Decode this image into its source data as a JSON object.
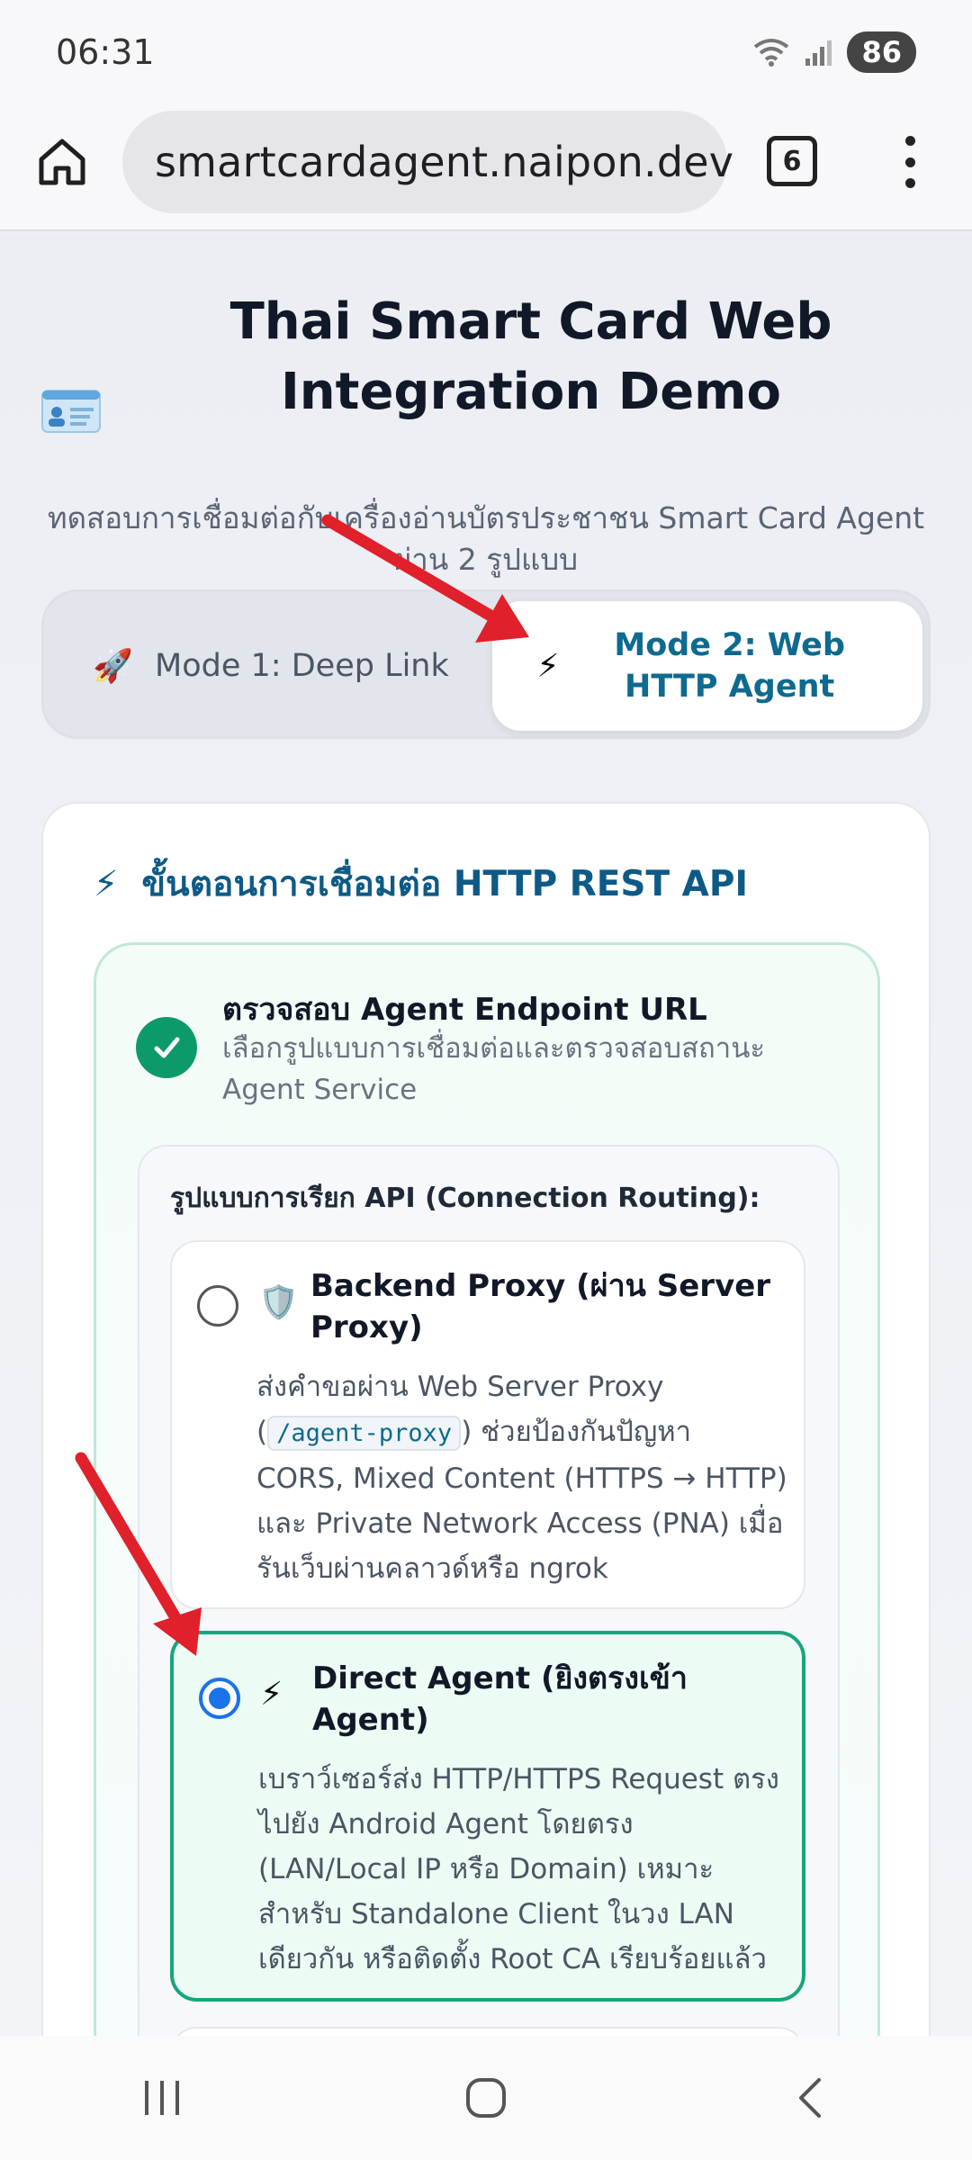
{
  "status_bar": {
    "time": "06:31",
    "battery": "86"
  },
  "browser": {
    "url": "smartcardagent.naipon.dev",
    "tab_count": "6"
  },
  "header": {
    "title": "Thai Smart Card Web Integration Demo",
    "subtitle": "ทดสอบการเชื่อมต่อกับเครื่องอ่านบัตรประชาชน Smart Card Agent ผ่าน 2 รูปแบบ"
  },
  "mode_tabs": [
    {
      "icon": "🚀",
      "label": "Mode 1: Deep Link",
      "active": false
    },
    {
      "icon": "⚡",
      "label": "Mode 2: Web HTTP Agent",
      "active": true
    }
  ],
  "card": {
    "icon": "⚡",
    "heading": "ขั้นตอนการเชื่อมต่อ HTTP REST API",
    "step": {
      "title": "ตรวจสอบ Agent Endpoint URL",
      "description": "เลือกรูปแบบการเชื่อมต่อและตรวจสอบสถานะ Agent Service",
      "routing_label": "รูปแบบการเรียก API (Connection Routing):",
      "options": [
        {
          "icon": "🛡️",
          "title": "Backend Proxy (ผ่าน Server Proxy)",
          "desc_before": "ส่งคำขอผ่าน Web Server Proxy (",
          "code": "/agent-proxy",
          "desc_after": ") ช่วยป้องกันปัญหา CORS, Mixed Content (HTTPS → HTTP) และ Private Network Access (PNA) เมื่อรันเว็บผ่านคลาวด์หรือ ngrok",
          "selected": false
        },
        {
          "icon": "⚡",
          "title": "Direct Agent (ยิงตรงเข้า Agent)",
          "desc": "เบราว์เซอร์ส่ง HTTP/HTTPS Request ตรงไปยัง Android Agent โดยตรง (LAN/Local IP หรือ Domain) เหมาะสำหรับ Standalone Client ในวง LAN เดียวกัน หรือติดตั้ง Root CA เรียบร้อยแล้ว",
          "selected": true
        }
      ]
    }
  },
  "colors": {
    "accent": "#0e6a8f",
    "success": "#0d9a6b",
    "selected_border": "#17a67c",
    "annotation_arrow": "#e0202a"
  }
}
